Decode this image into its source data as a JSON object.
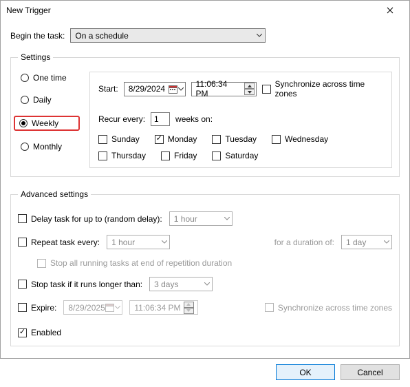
{
  "title": "New Trigger",
  "begin": {
    "label": "Begin the task:",
    "value": "On a schedule"
  },
  "settings": {
    "legend": "Settings",
    "freq": {
      "one_time": "One time",
      "daily": "Daily",
      "weekly": "Weekly",
      "monthly": "Monthly",
      "selected": "weekly"
    },
    "start_label": "Start:",
    "start_date": "8/29/2024",
    "start_time": "11:06:34 PM",
    "sync_tz": "Synchronize across time zones",
    "recur_label": "Recur every:",
    "recur_value": "1",
    "recur_unit": "weeks on:",
    "days": {
      "sun": "Sunday",
      "mon": "Monday",
      "tue": "Tuesday",
      "wed": "Wednesday",
      "thu": "Thursday",
      "fri": "Friday",
      "sat": "Saturday",
      "checked": "mon"
    }
  },
  "advanced": {
    "legend": "Advanced settings",
    "delay_label": "Delay task for up to (random delay):",
    "delay_value": "1 hour",
    "repeat_label": "Repeat task every:",
    "repeat_value": "1 hour",
    "duration_label": "for a duration of:",
    "duration_value": "1 day",
    "stop_all": "Stop all running tasks at end of repetition duration",
    "stop_long_label": "Stop task if it runs longer than:",
    "stop_long_value": "3 days",
    "expire_label": "Expire:",
    "expire_date": "8/29/2025",
    "expire_time": "11:06:34 PM",
    "sync_tz": "Synchronize across time zones",
    "enabled_label": "Enabled"
  },
  "buttons": {
    "ok": "OK",
    "cancel": "Cancel"
  }
}
